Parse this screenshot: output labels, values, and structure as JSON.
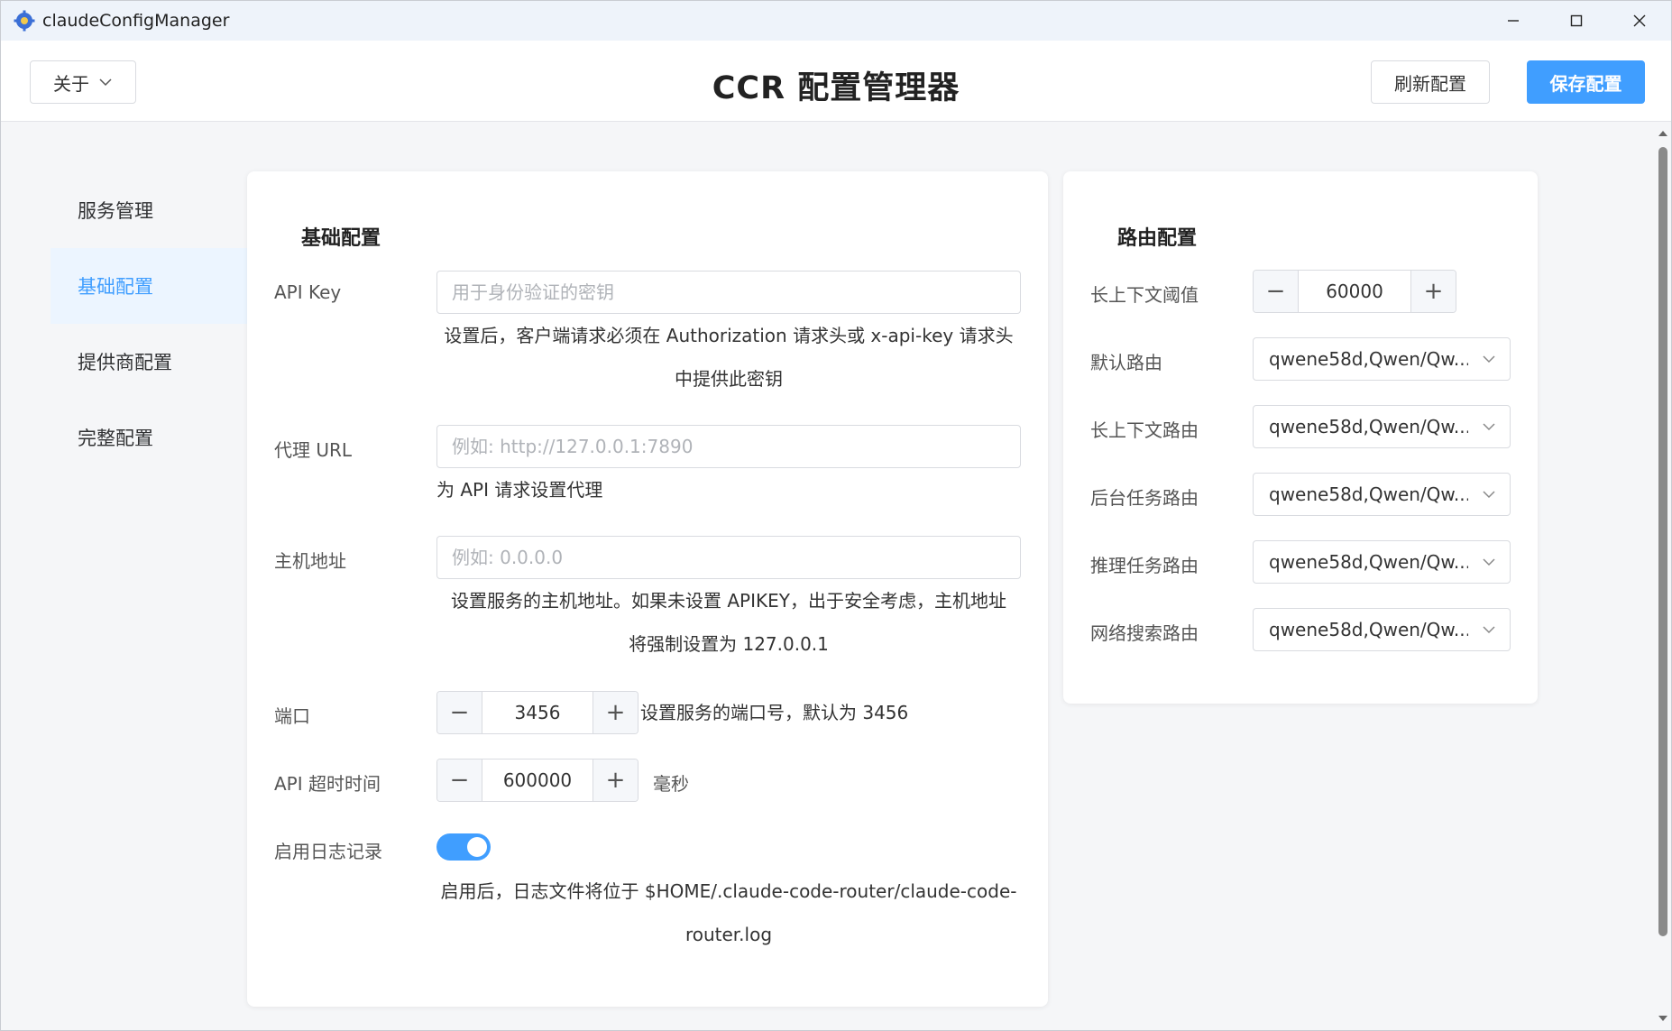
{
  "window": {
    "title": "claudeConfigManager"
  },
  "header": {
    "about_label": "关于",
    "title": "CCR 配置管理器",
    "refresh_label": "刷新配置",
    "save_label": "保存配置"
  },
  "sidebar": {
    "items": [
      {
        "label": "服务管理"
      },
      {
        "label": "基础配置"
      },
      {
        "label": "提供商配置"
      },
      {
        "label": "完整配置"
      }
    ]
  },
  "basic": {
    "title": "基础配置",
    "api_key": {
      "label": "API Key",
      "placeholder": "用于身份验证的密钥",
      "help_line1": "设置后，客户端请求必须在 Authorization 请求头或 x-api-key 请求头",
      "help_line2": "中提供此密钥"
    },
    "proxy": {
      "label": "代理 URL",
      "placeholder": "例如: http://127.0.0.1:7890",
      "help": "为 API 请求设置代理"
    },
    "host": {
      "label": "主机地址",
      "placeholder": "例如: 0.0.0.0",
      "help_line1": "设置服务的主机地址。如果未设置 APIKEY，出于安全考虑，主机地址",
      "help_line2": "将强制设置为 127.0.0.1"
    },
    "port": {
      "label": "端口",
      "value": "3456",
      "help": "设置服务的端口号，默认为 3456"
    },
    "timeout": {
      "label": "API 超时时间",
      "value": "600000",
      "unit": "毫秒"
    },
    "logging": {
      "label": "启用日志记录",
      "enabled": true,
      "help_line1": "启用后，日志文件将位于 $HOME/.claude-code-router/claude-code-",
      "help_line2": "router.log"
    }
  },
  "route": {
    "title": "路由配置",
    "long_context_threshold": {
      "label": "长上下文阈值",
      "value": "60000"
    },
    "default_route": {
      "label": "默认路由",
      "value": "qwene58d,Qwen/Qw..."
    },
    "long_context_route": {
      "label": "长上下文路由",
      "value": "qwene58d,Qwen/Qw..."
    },
    "background_route": {
      "label": "后台任务路由",
      "value": "qwene58d,Qwen/Qw..."
    },
    "think_route": {
      "label": "推理任务路由",
      "value": "qwene58d,Qwen/Qw..."
    },
    "web_search_route": {
      "label": "网络搜索路由",
      "value": "qwene58d,Qwen/Qw..."
    }
  },
  "colors": {
    "accent": "#409eff",
    "active_bg": "#ecf5ff"
  }
}
